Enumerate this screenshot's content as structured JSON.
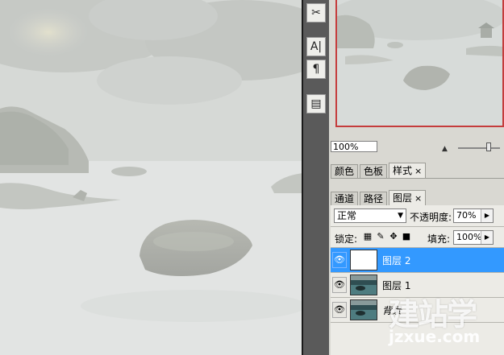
{
  "toolstrip": {
    "buttons": [
      {
        "icon": "tools-icon",
        "glyph": "✂"
      },
      {
        "icon": "character-icon",
        "glyph": "A|"
      },
      {
        "icon": "paragraph-icon",
        "glyph": "¶"
      },
      {
        "icon": "layer-comps-icon",
        "glyph": "▤"
      }
    ]
  },
  "navigator": {
    "zoom": "100%"
  },
  "panel_tabs_top": {
    "tabs": [
      "颜色",
      "色板",
      "样式"
    ],
    "close": "×"
  },
  "panel_tabs_layers": {
    "tabs": [
      "通道",
      "路径",
      "图层"
    ],
    "close": "×"
  },
  "layers": {
    "blend_mode": "正常",
    "opacity_label": "不透明度:",
    "opacity_value": "70%",
    "lock_label": "锁定:",
    "fill_label": "填充:",
    "fill_value": "100%",
    "rows": [
      {
        "name": "图层 2",
        "selected": true
      },
      {
        "name": "图层 1",
        "selected": false
      },
      {
        "name": "背景",
        "selected": false
      }
    ]
  },
  "watermark": {
    "cn": "建站学",
    "en": "jzxue.com"
  },
  "colors": {
    "selection": "#3399ff",
    "navigator_frame": "#c53c3c"
  }
}
